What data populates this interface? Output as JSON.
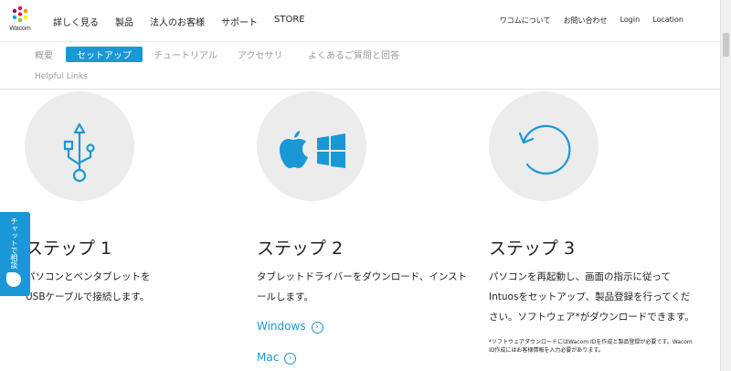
{
  "header": {
    "logo_text": "Wacom",
    "nav": [
      "詳しく見る",
      "製品",
      "法人のお客様",
      "サポート",
      "STORE"
    ],
    "utility": [
      "ワコムについて",
      "お問い合わせ",
      "Login",
      "Location"
    ]
  },
  "tabs": {
    "overview": "概要",
    "setup": "セットアップ",
    "tutorial": "チュートリアル",
    "accessories": "アクセサリ",
    "faq": "よくあるご質問と回答",
    "helpful": "Helpful Links"
  },
  "steps": [
    {
      "title": "ステップ 1",
      "line1": "パソコンとペンタブレットを",
      "line2": "USBケーブルで接続します。"
    },
    {
      "title": "ステップ 2",
      "line1": "タブレットドライバーをダウンロード、インスト",
      "line2": "ールします。",
      "link_windows": "Windows",
      "link_mac": "Mac"
    },
    {
      "title": "ステップ 3",
      "line1": "パソコンを再起動し、画面の指示に従って",
      "line2": "Intuosをセットアップ、製品登録を行ってくだ",
      "line3": "さい。ソフトウェア*がダウンロードできます。",
      "note1": "*ソフトウェアダウンロードにはWacom IDを作成と製品登録が必要です。Wacom",
      "note2": "ID作成にはお客様情報を入力必要があります。"
    }
  ],
  "chat": {
    "label": "チャットで相談"
  },
  "colors": {
    "accent": "#1a97d5",
    "circle": "#ececec"
  }
}
